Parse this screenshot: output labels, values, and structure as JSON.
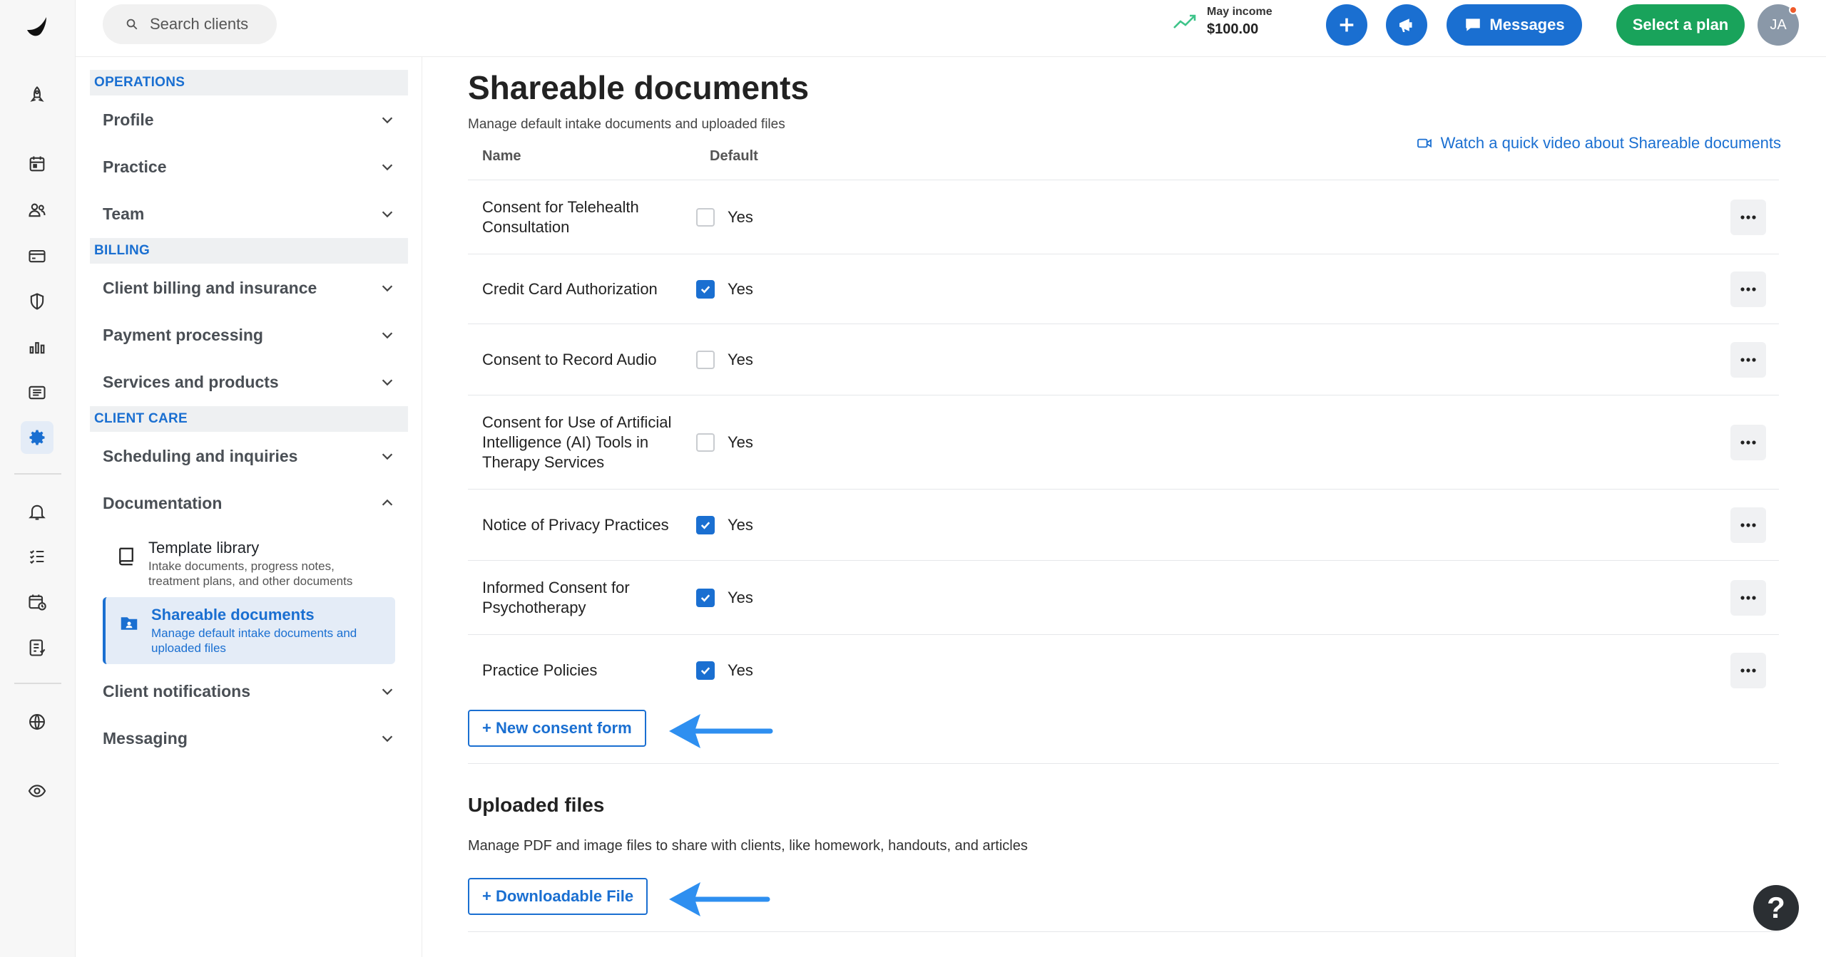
{
  "topbar": {
    "search_placeholder": "Search clients",
    "income_label": "May income",
    "income_value": "$100.00",
    "messages_label": "Messages",
    "plan_label": "Select a plan",
    "avatar_initials": "JA"
  },
  "sidebar": {
    "sections": {
      "operations": "OPERATIONS",
      "billing": "BILLING",
      "client_care": "CLIENT CARE"
    },
    "items": {
      "profile": "Profile",
      "practice": "Practice",
      "team": "Team",
      "client_billing": "Client billing and insurance",
      "payment_processing": "Payment processing",
      "services_products": "Services and products",
      "scheduling": "Scheduling and inquiries",
      "documentation": "Documentation",
      "client_notifications": "Client notifications",
      "messaging": "Messaging"
    },
    "sub_items": {
      "template_library": {
        "title": "Template library",
        "desc": "Intake documents, progress notes, treatment plans, and other documents"
      },
      "shareable_documents": {
        "title": "Shareable documents",
        "desc": "Manage default intake documents and uploaded files"
      }
    }
  },
  "main": {
    "title": "Shareable documents",
    "subtitle": "Manage default intake documents and uploaded files",
    "video_link": "Watch a quick video about Shareable documents",
    "col_name": "Name",
    "col_default": "Default",
    "documents": [
      {
        "name": "Consent for Telehealth Consultation",
        "default_label": "Yes",
        "checked": false
      },
      {
        "name": "Credit Card Authorization",
        "default_label": "Yes",
        "checked": true
      },
      {
        "name": "Consent to Record Audio",
        "default_label": "Yes",
        "checked": false
      },
      {
        "name": "Consent for Use of Artificial Intelligence (AI) Tools in Therapy Services",
        "default_label": "Yes",
        "checked": false
      },
      {
        "name": "Notice of Privacy Practices",
        "default_label": "Yes",
        "checked": true
      },
      {
        "name": "Informed Consent for Psychotherapy",
        "default_label": "Yes",
        "checked": true
      },
      {
        "name": "Practice Policies",
        "default_label": "Yes",
        "checked": true
      }
    ],
    "new_consent_button": "+ New consent form",
    "uploaded_title": "Uploaded files",
    "uploaded_desc": "Manage PDF and image files to share with clients, like homework, handouts, and articles",
    "downloadable_button": "+ Downloadable File"
  },
  "help_label": "?",
  "colors": {
    "accent": "#1a6fd1",
    "plan_green": "#19a35b",
    "arrow_blue": "#2e8ff0"
  }
}
